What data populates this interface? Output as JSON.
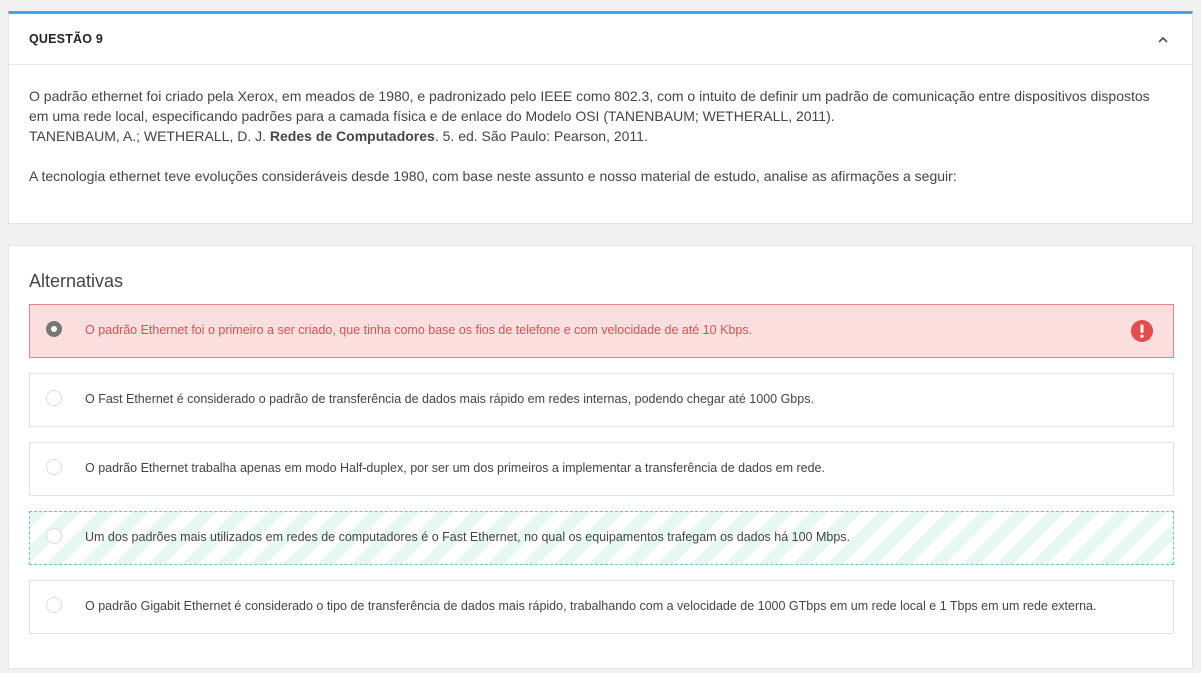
{
  "question": {
    "title": "QUESTÃO 9",
    "collapse_icon": "chevron-up-icon",
    "paragraph1": "O padrão ethernet foi criado pela Xerox, em meados de 1980, e padronizado pelo IEEE como 802.3, com o intuito de definir um padrão de comunicação entre dispositivos dispostos em uma rede local, especificando padrões para a camada física e de enlace do Modelo OSI (TANENBAUM; WETHERALL, 2011).",
    "reference_prefix": "TANENBAUM, A.; WETHERALL, D. J. ",
    "reference_bold": "Redes de Computadores",
    "reference_suffix": ". 5. ed. São Paulo: Pearson, 2011.",
    "paragraph2": "A tecnologia ethernet teve evoluções consideráveis desde 1980, com base neste assunto e nosso material de estudo, analise as afirmações a seguir:"
  },
  "alternatives": {
    "title": "Alternativas",
    "options": [
      {
        "label": "O padrão Ethernet foi o primeiro a ser criado, que tinha como base os fios de telefone e com velocidade de até 10 Kbps.",
        "selected": true,
        "state": "wrong"
      },
      {
        "label": "O Fast Ethernet é considerado o padrão de transferência de dados mais rápido em redes internas, podendo chegar até 1000 Gbps.",
        "selected": false,
        "state": "neutral"
      },
      {
        "label": "O padrão Ethernet trabalha apenas em modo Half-duplex, por ser um dos primeiros a implementar a transferência de dados em rede.",
        "selected": false,
        "state": "neutral"
      },
      {
        "label": "Um dos padrões mais utilizados em redes de computadores é o Fast Ethernet, no qual os equipamentos trafegam os dados há 100 Mbps.",
        "selected": false,
        "state": "correct"
      },
      {
        "label": "O padrão Gigabit Ethernet é considerado o tipo de transferência de dados mais rápido, trabalhando com a velocidade de 1000 GTbps em um rede local e 1 Tbps em um rede externa.",
        "selected": false,
        "state": "neutral"
      }
    ],
    "wrong_icon": "exclamation-circle-icon"
  },
  "colors": {
    "accent": "#4aa3e8",
    "wrong_bg": "#fddfe0",
    "wrong_text": "#d9534f",
    "correct_border": "#5fd1b4"
  }
}
